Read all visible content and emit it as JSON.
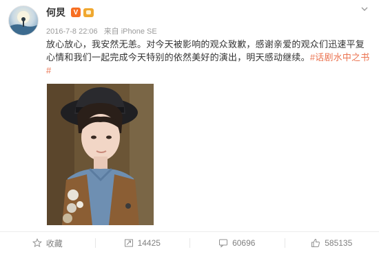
{
  "post": {
    "username": "何炅",
    "verified_badge": "V",
    "timestamp": "2016-7-8 22:06",
    "source": "来自 iPhone SE",
    "text_main": "放心放心，我安然无恙。对今天被影响的观众致歉，感谢亲爱的观众们迅速平复心情和我们一起完成今天特别的依然美好的演出，明天感动继续。",
    "hashtag": "#话剧水中之书#",
    "photo_description": "selfie"
  },
  "actions": {
    "favorite_label": "收藏",
    "repost_count": "14425",
    "comment_count": "60696",
    "like_count": "585135"
  },
  "colors": {
    "hashtag": "#eb7350",
    "verified": "#f76f23",
    "meta_text": "#9a9a9a"
  },
  "icons": [
    "chevron-down-icon",
    "star-icon",
    "repost-icon",
    "comment-icon",
    "like-icon"
  ]
}
